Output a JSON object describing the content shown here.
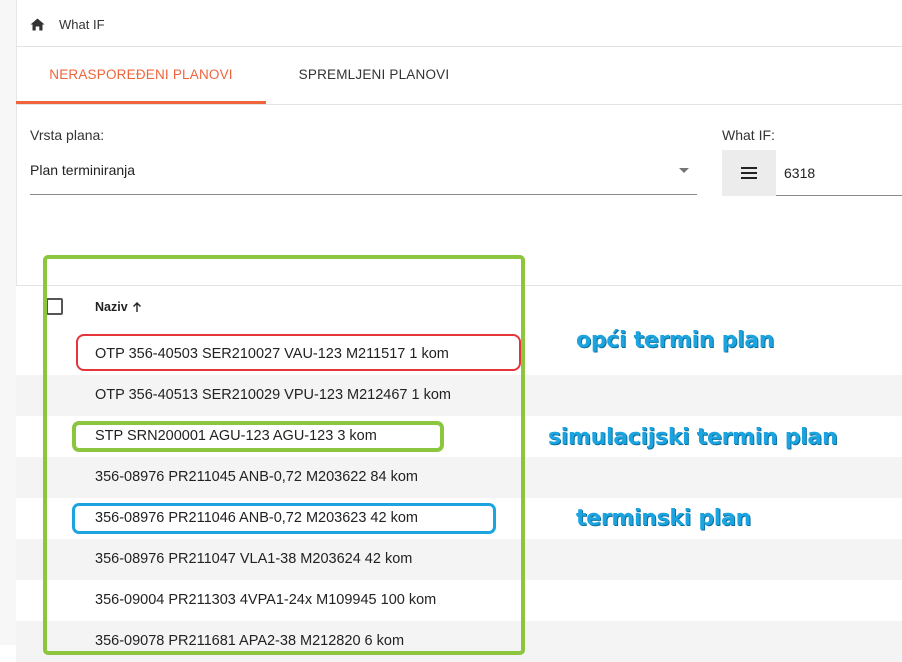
{
  "breadcrumb": {
    "home_icon": "home-icon",
    "label": "What IF"
  },
  "tabs": [
    {
      "label": "NERASPOREĐENI PLANOVI",
      "active": true
    },
    {
      "label": "SPREMLJENI PLANOVI",
      "active": false
    }
  ],
  "form": {
    "plan_type_label": "Vrsta plana:",
    "plan_type_value": "Plan terminiranja",
    "whatif_label": "What IF:",
    "whatif_menu_icon": "menu-icon",
    "whatif_value": "6318"
  },
  "table": {
    "column_header": "Naziv",
    "sort_icon": "arrow-up-icon",
    "rows": [
      "OTP 356-40503 SER210027 VAU-123 M211517 1 kom",
      "OTP 356-40513 SER210029 VPU-123 M212467 1 kom",
      "STP SRN200001 AGU-123 AGU-123 3 kom",
      "356-08976 PR211045 ANB-0,72 M203622 84 kom",
      "356-08976 PR211046 ANB-0,72 M203623 42 kom",
      "356-08976 PR211047 VLA1-38 M203624 42 kom",
      "356-09004 PR211303 4VPA1-24x M109945 100 kom",
      "356-09078 PR211681 APA2-38 M212820 6 kom"
    ]
  },
  "annotations": {
    "general": "opći termin plan",
    "simulation": "simulacijski termin plan",
    "term": "terminski plan"
  },
  "colors": {
    "accent": "#f0643c",
    "annotation_text": "#1ba4e0",
    "box_green": "#8cc63f",
    "box_red": "#e5343a",
    "box_blue": "#1ba4e0"
  }
}
